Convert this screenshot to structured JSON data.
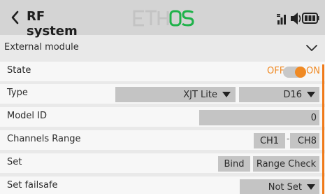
{
  "header": {
    "title": "RF system",
    "logo_text": "ETHOS",
    "colors": {
      "bar": "#d4d4d4",
      "logo_left": "#c0c0c0",
      "logo_right": "#1fb24a"
    }
  },
  "section": {
    "label": "External module",
    "icon": "chevron-down-icon"
  },
  "state": {
    "label": "State",
    "off_label": "OFF",
    "on_label": "ON",
    "value": true,
    "accent": "#f08a24"
  },
  "type": {
    "label": "Type",
    "module_value": "XJT Lite",
    "mode_value": "D16"
  },
  "model_id": {
    "label": "Model ID",
    "value": "0"
  },
  "channels_range": {
    "label": "Channels Range",
    "start": "CH1",
    "separator": "-",
    "end": "CH8"
  },
  "set": {
    "label": "Set",
    "bind_label": "Bind",
    "range_check_label": "Range Check"
  },
  "failsafe": {
    "label": "Set failsafe",
    "value": "Not Set"
  }
}
